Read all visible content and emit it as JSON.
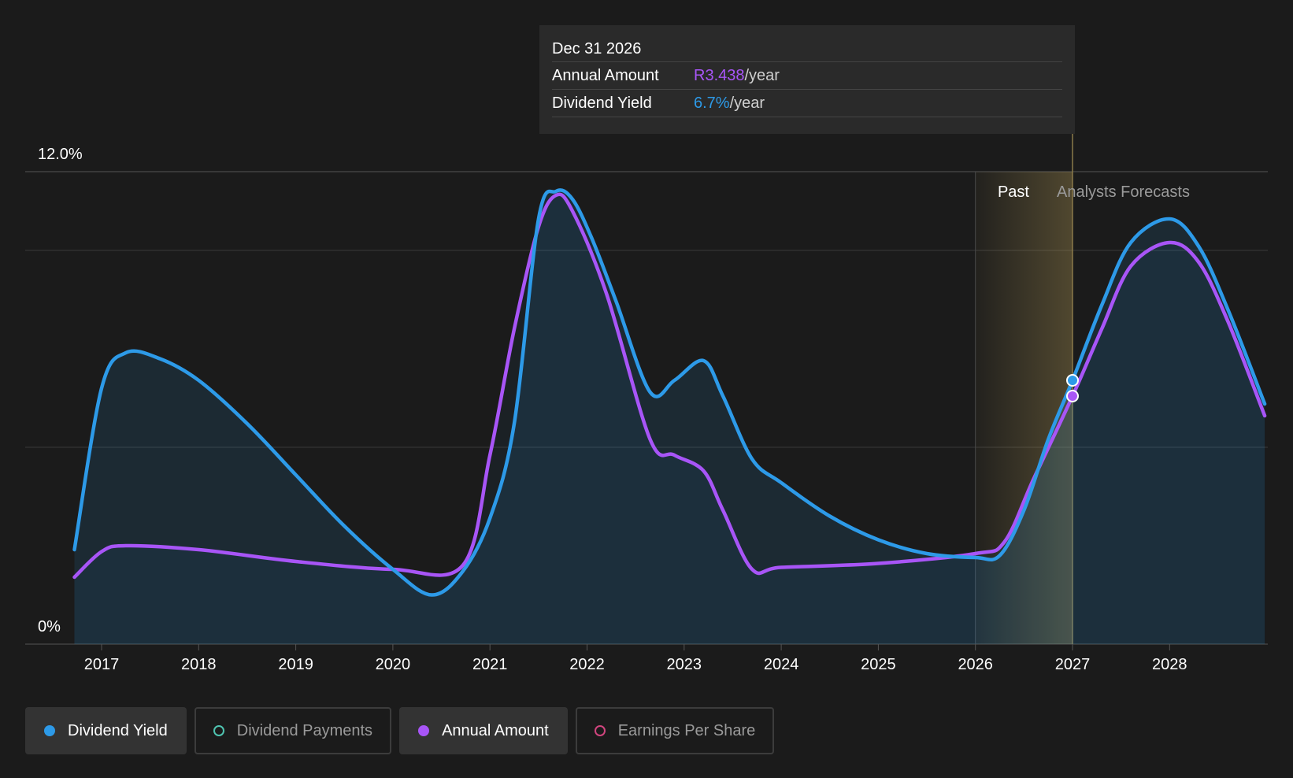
{
  "chart_data": {
    "type": "line",
    "x_ticks": [
      "2017",
      "2018",
      "2019",
      "2020",
      "2021",
      "2022",
      "2023",
      "2024",
      "2025",
      "2026",
      "2027",
      "2028"
    ],
    "y_ticks": [
      "12.0%",
      "0%"
    ],
    "ylim": [
      0,
      12
    ],
    "xlim": [
      2016.7,
      2028.98
    ],
    "region_labels": {
      "past": "Past",
      "forecast": "Analysts Forecasts"
    },
    "grid": true,
    "series": [
      {
        "name": "Dividend Yield",
        "color": "#2d9ae8",
        "x": [
          2016.72,
          2017.0,
          2017.25,
          2017.6,
          2018.0,
          2018.5,
          2019.0,
          2019.5,
          2020.0,
          2020.4,
          2020.72,
          2021.0,
          2021.25,
          2021.5,
          2021.68,
          2021.85,
          2022.05,
          2022.3,
          2022.65,
          2022.9,
          2023.2,
          2023.4,
          2023.7,
          2024.0,
          2024.5,
          2025.0,
          2025.5,
          2026.0,
          2026.25,
          2026.5,
          2026.75,
          2027.0,
          2027.3,
          2027.6,
          2028.0,
          2028.3,
          2028.6,
          2028.98
        ],
        "y": [
          2.4,
          6.5,
          7.4,
          7.25,
          6.7,
          5.6,
          4.3,
          3.0,
          1.9,
          1.25,
          1.85,
          3.2,
          5.6,
          10.8,
          11.5,
          11.3,
          10.3,
          8.7,
          6.4,
          6.7,
          7.2,
          6.3,
          4.7,
          4.1,
          3.25,
          2.65,
          2.3,
          2.2,
          2.25,
          3.4,
          5.2,
          6.7,
          8.6,
          10.2,
          10.8,
          10.1,
          8.5,
          6.1
        ]
      },
      {
        "name": "Annual Amount",
        "color": "#a855f7",
        "x": [
          2016.72,
          2017.0,
          2017.25,
          2018.0,
          2019.0,
          2020.0,
          2020.72,
          2021.0,
          2021.25,
          2021.5,
          2021.68,
          2021.85,
          2022.2,
          2022.65,
          2022.9,
          2023.2,
          2023.4,
          2023.7,
          2024.0,
          2025.0,
          2026.0,
          2026.3,
          2026.6,
          2027.0,
          2027.3,
          2027.6,
          2028.0,
          2028.3,
          2028.6,
          2028.98
        ],
        "y": [
          1.7,
          2.35,
          2.5,
          2.4,
          2.1,
          1.9,
          2.0,
          4.8,
          8.0,
          10.6,
          11.4,
          11.0,
          8.9,
          5.2,
          4.8,
          4.4,
          3.4,
          1.9,
          1.95,
          2.05,
          2.3,
          2.6,
          4.2,
          6.3,
          8.0,
          9.6,
          10.2,
          9.7,
          8.2,
          5.8
        ]
      }
    ],
    "tooltip": {
      "date": "Dec 31 2026",
      "rows": [
        {
          "label": "Annual Amount",
          "value": "R3.438",
          "unit": "/year"
        },
        {
          "label": "Dividend Yield",
          "value": "6.7%",
          "unit": "/year"
        }
      ]
    }
  },
  "legend": [
    {
      "label": "Dividend Yield",
      "color": "#2d9ae8",
      "active": true
    },
    {
      "label": "Dividend Payments",
      "color": "#4fc3b0",
      "active": false
    },
    {
      "label": "Annual Amount",
      "color": "#a855f7",
      "active": true
    },
    {
      "label": "Earnings Per Share",
      "color": "#d0457e",
      "active": false
    }
  ]
}
